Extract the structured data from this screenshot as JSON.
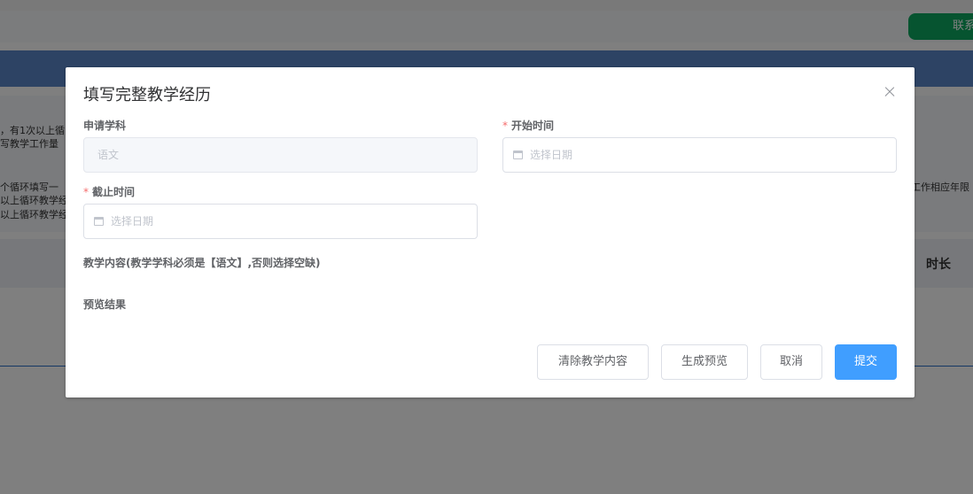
{
  "background": {
    "contact_button_label": "联系",
    "notice_lines": [
      "，有1次以上循",
      "写教学工作量",
      "个循环填写一",
      "以上循环教学经",
      "以上循环教学经"
    ],
    "notice_right_fragment": "工作相应年限",
    "table_header_duration": "时长"
  },
  "dialog": {
    "title": "填写完整教学经历",
    "close_icon": "close-icon",
    "fields": {
      "subject": {
        "label": "申请学科",
        "value": "语文",
        "disabled": true
      },
      "start_time": {
        "label": "开始时间",
        "required_mark": "*",
        "placeholder": "选择日期",
        "icon": "calendar-icon"
      },
      "end_time": {
        "label": "截止时间",
        "required_mark": "*",
        "placeholder": "选择日期",
        "icon": "calendar-icon"
      }
    },
    "teaching_content_label": "教学内容(教学学科必须是【语文】,否则选择空缺)",
    "preview_label": "预览结果",
    "buttons": {
      "clear": "清除教学内容",
      "preview": "生成预览",
      "cancel": "取消",
      "submit": "提交"
    }
  },
  "colors": {
    "primary": "#409eff",
    "required": "#f56c6c",
    "contact_button": "#0ca860",
    "banner": "#5b86c9"
  }
}
